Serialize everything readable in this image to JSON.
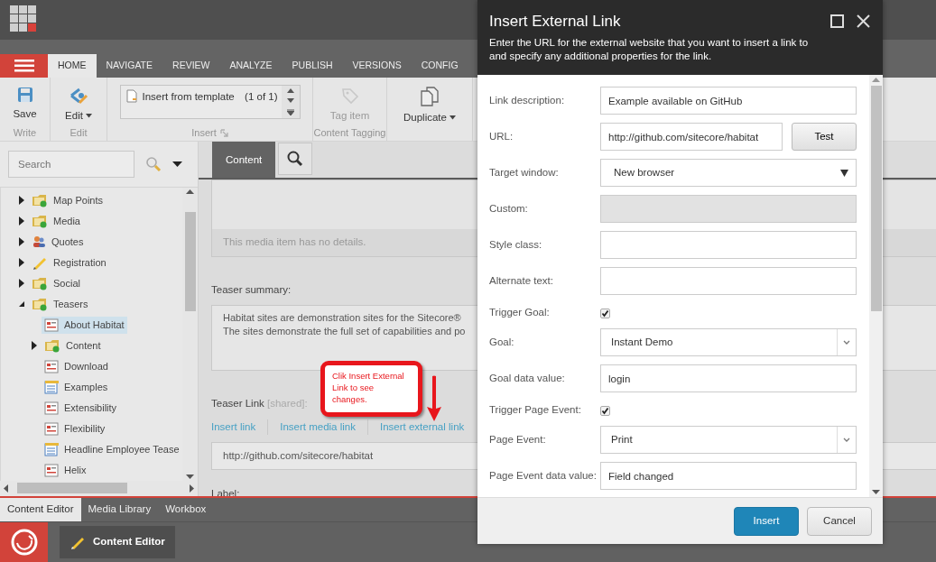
{
  "ribbon_tabs": [
    {
      "kind": "menu",
      "selected": false
    },
    {
      "label": "HOME",
      "selected": true
    },
    {
      "label": "NAVIGATE",
      "selected": false
    },
    {
      "label": "REVIEW",
      "selected": false
    },
    {
      "label": "ANALYZE",
      "selected": false
    },
    {
      "label": "PUBLISH",
      "selected": false
    },
    {
      "label": "VERSIONS",
      "selected": false
    },
    {
      "label": "CONFIG",
      "selected": false
    }
  ],
  "ribbon_groups": [
    {
      "label": "Write",
      "items": [
        {
          "kind": "save",
          "label": "Save",
          "dropdown": false,
          "disabled": false
        }
      ]
    },
    {
      "label": "Edit",
      "items": [
        {
          "kind": "edit",
          "label": "Edit",
          "dropdown": true,
          "disabled": false
        }
      ]
    },
    {
      "label": "Insert",
      "gallery": {
        "item": "Insert from template",
        "count": "(1 of 1)"
      }
    },
    {
      "label": "Content Tagging",
      "items": [
        {
          "kind": "tag",
          "label": "Tag item",
          "dropdown": false,
          "disabled": true
        }
      ]
    },
    {
      "items": [
        {
          "kind": "duplicate",
          "label": "Duplicate",
          "dropdown": true,
          "disabled": false
        }
      ]
    }
  ],
  "tree": {
    "search": {
      "placeholder": "Search"
    },
    "items": [
      {
        "label": "Map Points",
        "kind": "folder",
        "expanded": false,
        "selected": false
      },
      {
        "label": "Media",
        "kind": "folder",
        "expanded": false,
        "selected": false
      },
      {
        "label": "Quotes",
        "kind": "people",
        "expanded": false,
        "selected": false
      },
      {
        "label": "Registration",
        "kind": "pencil",
        "expanded": false,
        "selected": false
      },
      {
        "label": "Social",
        "kind": "folder",
        "expanded": false,
        "selected": false
      },
      {
        "label": "Teasers",
        "kind": "folder",
        "expanded": true,
        "selected": false,
        "children": [
          {
            "label": "About Habitat",
            "kind": "page",
            "selected": true
          },
          {
            "label": "Content",
            "kind": "folder",
            "expanded": false,
            "selected": false
          },
          {
            "label": "Download",
            "kind": "page",
            "selected": false
          },
          {
            "label": "Examples",
            "kind": "list",
            "selected": false
          },
          {
            "label": "Extensibility",
            "kind": "page",
            "selected": false
          },
          {
            "label": "Flexibility",
            "kind": "page",
            "selected": false
          },
          {
            "label": "Headline Employee Tease",
            "kind": "list",
            "selected": false
          },
          {
            "label": "Helix",
            "kind": "page",
            "selected": false
          }
        ]
      }
    ]
  },
  "content": {
    "tabs": [
      {
        "kind": "text",
        "label": "Content",
        "selected": true
      },
      {
        "kind": "search",
        "selected": false
      }
    ],
    "media_note": "This media item has no details.",
    "fields": [
      {
        "kind": "textarea",
        "label": "Teaser summary:",
        "lines": [
          "Habitat sites are demonstration sites for the Sitecore®",
          "The sites demonstrate the full set of capabilities and po"
        ]
      },
      {
        "kind": "link",
        "label": "Teaser Link",
        "note": "[shared]:",
        "actions": [
          "Insert link",
          "Insert media link",
          "Insert external link"
        ],
        "value": "http://github.com/sitecore/habitat"
      },
      {
        "kind": "heading",
        "label": "Label:"
      }
    ]
  },
  "callout": {
    "text": "Clik Insert External Link to see changes."
  },
  "bottom_tabs": [
    {
      "label": "Content Editor",
      "selected": true
    },
    {
      "label": "Media Library",
      "selected": false
    },
    {
      "label": "Workbox",
      "selected": false
    }
  ],
  "taskbar": {
    "apps": [
      "Content Editor"
    ]
  },
  "dialog": {
    "title": "Insert External Link",
    "description": "Enter the URL for the external website that you want to insert a link to and specify any additional properties for the link.",
    "fields": [
      {
        "label": "Link description:",
        "kind": "text",
        "value": "Example available on GitHub",
        "disabled": false
      },
      {
        "label": "URL:",
        "kind": "text_button",
        "value": "http://github.com/sitecore/habitat",
        "button": "Test"
      },
      {
        "label": "Target window:",
        "kind": "select",
        "value": "New browser"
      },
      {
        "label": "Custom:",
        "kind": "text",
        "disabled": true
      },
      {
        "label": "Style class:",
        "kind": "text",
        "disabled": false
      },
      {
        "label": "Alternate text:",
        "kind": "text",
        "disabled": false
      },
      {
        "label": "Trigger Goal:",
        "kind": "checkbox",
        "checked": true
      },
      {
        "label": "Goal:",
        "kind": "combo",
        "value": "Instant Demo"
      },
      {
        "label": "Goal data value:",
        "kind": "text",
        "value": "login",
        "disabled": false
      },
      {
        "label": "Trigger Page Event:",
        "kind": "checkbox",
        "checked": true
      },
      {
        "label": "Page Event:",
        "kind": "combo",
        "value": "Print"
      },
      {
        "label": "Page Event data value:",
        "kind": "text",
        "value": "Field changed",
        "disabled": false
      }
    ],
    "buttons": [
      {
        "label": "Insert",
        "primary": true
      },
      {
        "label": "Cancel",
        "primary": false
      }
    ]
  }
}
